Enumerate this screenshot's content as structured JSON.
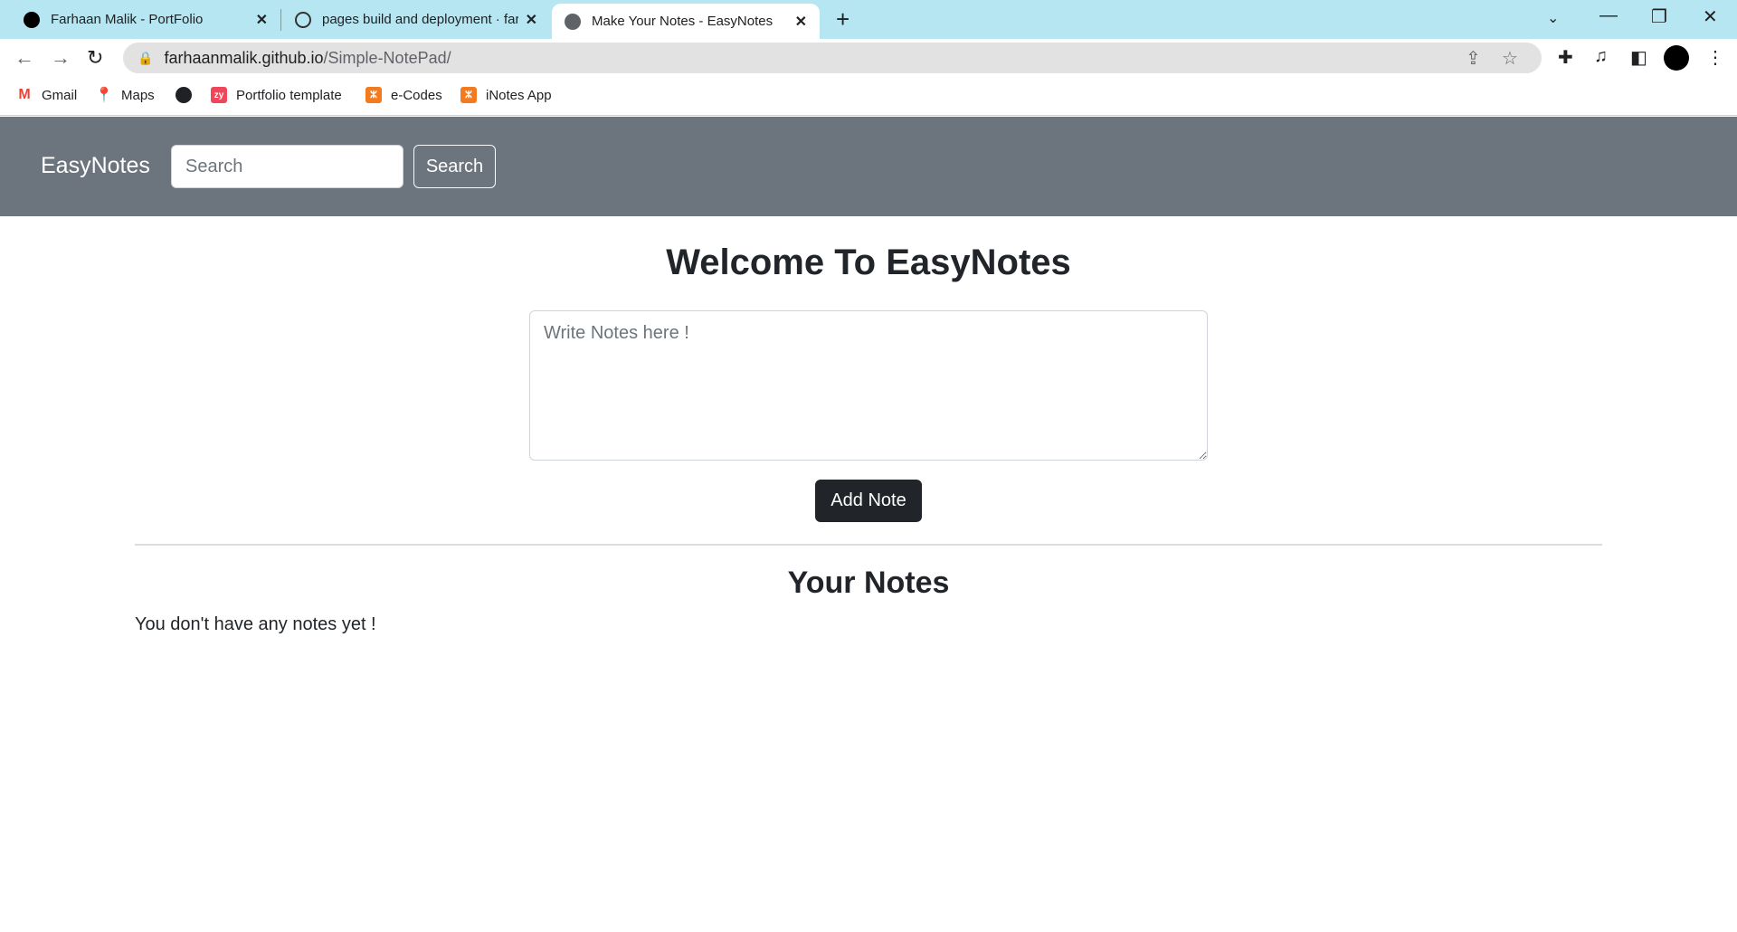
{
  "browser": {
    "tabs": [
      {
        "title": "Farhaan Malik - PortFolio",
        "favicon": "pf-logo"
      },
      {
        "title": "pages build and deployment · farhaanmalik/Simple-NotePad",
        "favicon": "github-icon"
      },
      {
        "title": "Make Your Notes - EasyNotes",
        "favicon": "globe-icon"
      }
    ],
    "url_host": "farhaanmalik.github.io",
    "url_path": "/Simple-NotePad/",
    "bookmarks": [
      {
        "label": "Gmail",
        "icon": "gmail-icon"
      },
      {
        "label": "Maps",
        "icon": "maps-icon"
      },
      {
        "label": "",
        "icon": "globe-icon"
      },
      {
        "label": "Portfolio template",
        "icon": "zyro-icon"
      },
      {
        "label": "e-Codes",
        "icon": "xampp-icon"
      },
      {
        "label": "iNotes App",
        "icon": "xampp-icon"
      }
    ],
    "colors": {
      "tabbar": "#b6e6f2"
    }
  },
  "navbar": {
    "brand": "EasyNotes",
    "search_placeholder": "Search",
    "search_button": "Search",
    "color": "#6c757d"
  },
  "main": {
    "title": "Welcome To EasyNotes",
    "note_placeholder": "Write Notes here !",
    "add_button": "Add Note",
    "notes_title": "Your Notes",
    "empty_message": "You don't have any notes yet !"
  }
}
